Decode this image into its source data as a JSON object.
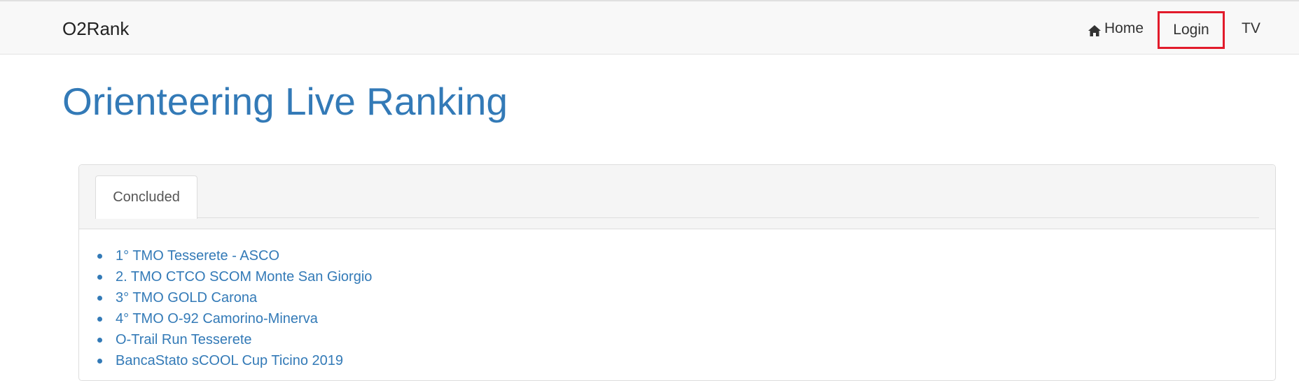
{
  "navbar": {
    "brand": "O2Rank",
    "home_label": "Home",
    "login_label": "Login",
    "tv_label": "TV"
  },
  "main": {
    "title": "Orienteering Live Ranking",
    "tabs": [
      {
        "label": "Concluded",
        "active": true
      }
    ],
    "races": [
      "1° TMO Tesserete - ASCO",
      "2. TMO CTCO SCOM Monte San Giorgio",
      "3° TMO GOLD Carona",
      "4° TMO O-92 Camorino-Minerva",
      "O-Trail Run Tesserete",
      "BancaStato sCOOL Cup Ticino 2019"
    ]
  },
  "colors": {
    "link": "#337ab7",
    "highlight_border": "#e21b2b",
    "navbar_bg": "#f8f8f8"
  },
  "icons": {
    "home": "home-icon"
  }
}
